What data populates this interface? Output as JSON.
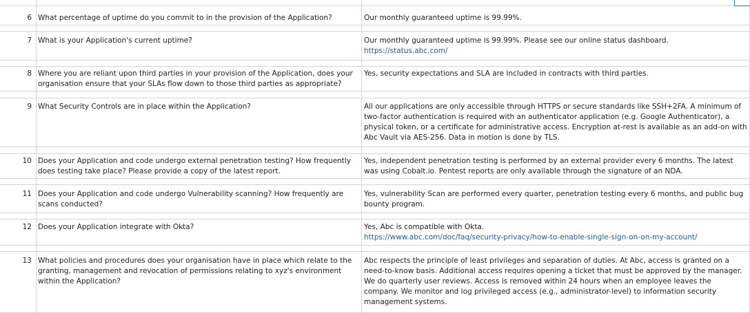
{
  "rows": [
    {
      "num": "6",
      "question": "What percentage of uptime do you commit to in the provision of the Application?",
      "answer": "Our monthly guaranteed uptime is 99.99%.",
      "link": ""
    },
    {
      "num": "7",
      "question": "What is your Application's current uptime?",
      "answer": "Our monthly guaranteed uptime is 99.99%. Please see our online status dashboard.",
      "link": "https://status.abc.com/"
    },
    {
      "num": "8",
      "question": "Where you are reliant upon third parties in your provision of the Application, does your organisation ensure that your SLAs flow down to those third parties as appropriate?",
      "answer": "Yes, security expectations and SLA are included in contracts with third parties.",
      "link": ""
    },
    {
      "num": "9",
      "question": "What Security Controls are in place within the Application?",
      "answer": "All our applications are only accessible through HTTPS or secure standards like SSH+2FA. A minimum of two-factor authentication is required with an authenticator application (e.g. Google Authenticator), a physical token, or a certificate for administrative access. Encryption at-rest is available as an add-on with Abc Vault via AES-256. Data in motion is done by TLS.",
      "link": ""
    },
    {
      "num": "10",
      "question": "Does your Application and code undergo external penetration testing? How frequently does testing take place? Please provide a copy of the latest report.",
      "answer": "Yes, independent penetration testing is performed by an external provider every 6 months. The latest was using Cobalt.io. Pentest reports are only available through the signature of an NDA.",
      "link": ""
    },
    {
      "num": "11",
      "question": "Does your Application and code undergo Vulnerability scanning? How frequently are scans conducted?",
      "answer": "Yes, vulnerability Scan are performed every quarter, penetration testing every 6 months, and public bug bounty program.",
      "link": ""
    },
    {
      "num": "12",
      "question": "Does your Application integrate with Okta?",
      "answer": "Yes, Abc is compatible with Okta.",
      "link": "https://www.abc.com/doc/faq/security-privacy/how-to-enable-single-sign-on-on-my-account/"
    },
    {
      "num": "13",
      "question": "What policies and procedures does your organisation have in place which relate to the granting, management and revocation of permissions relating to xyz's environment within the Application?",
      "answer": "Abc respects the principle of least privileges and separation of duties. At Abc, access is granted on a need-to-know basis. Additional access requires opening a ticket that must be approved by the manager. We do quarterly user reviews. Access is removed within 24 hours when an employee leaves the company. We monitor and log privileged access (e.g., administrator-level) to information security management systems.",
      "link": ""
    }
  ]
}
